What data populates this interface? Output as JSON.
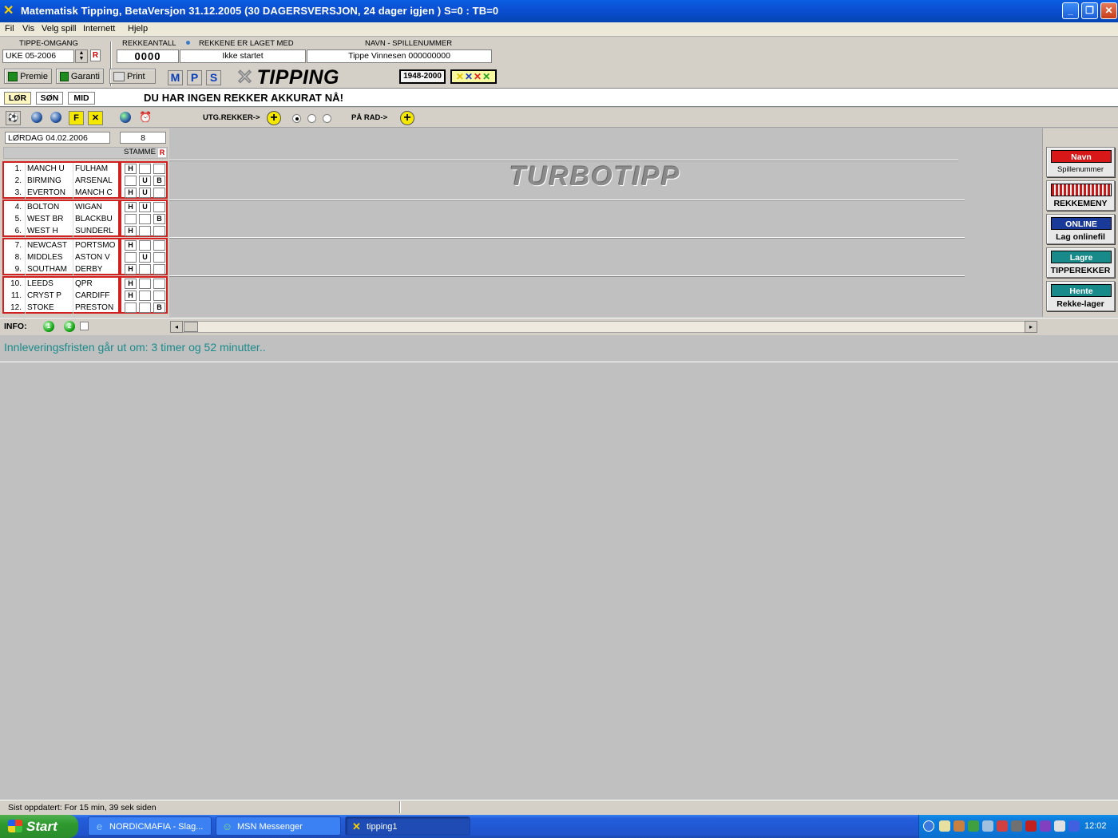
{
  "window": {
    "title": "Matematisk Tipping, BetaVersjon 31.12.2005 (30 DAGERSVERSJON, 24 dager igjen ) S=0 : TB=0",
    "minimize": "_",
    "maximize": "❐",
    "close": "✕"
  },
  "menu": [
    "Fil",
    "Vis",
    "Velg spill",
    "Internett",
    "Hjelp"
  ],
  "header": {
    "omgang_label": "TIPPE-OMGANG",
    "omgang_value": "UKE 05-2006",
    "r_button": "R",
    "rekkeantall_label": "REKKEANTALL",
    "rekkeantall_value": "0000",
    "laget_label": "REKKENE ER LAGET MED",
    "laget_value": "Ikke startet",
    "navn_label": "NAVN  -  SPILLENUMMER",
    "navn_value": "Tippe Vinnesen 000000000"
  },
  "toolbar": {
    "premie": "Premie",
    "garanti": "Garanti",
    "print": "Print",
    "m": "M",
    "p": "P",
    "s": "S",
    "logo": "TIPPING",
    "years": "1948-2000"
  },
  "days": {
    "tabs": [
      "LØR",
      "SØN",
      "MID"
    ],
    "message": "DU HAR INGEN REKKER AKKURAT NÅ!"
  },
  "iconbar": {
    "f_label": "F",
    "x_label": "✕",
    "utg_label": "UTG.REKKER->",
    "pa_rad_label": "PÅ RAD->",
    "plus": "+"
  },
  "coupon": {
    "date": "LØRDAG 04.02.2006",
    "count": "8",
    "stamme": "STAMME",
    "stamme_r": "R",
    "matches": [
      {
        "num": "1.",
        "home": "MANCH U",
        "away": "FULHAM",
        "marks": [
          "H",
          "",
          ""
        ]
      },
      {
        "num": "2.",
        "home": "BIRMING",
        "away": "ARSENAL",
        "marks": [
          "",
          "U",
          "B"
        ]
      },
      {
        "num": "3.",
        "home": "EVERTON",
        "away": "MANCH C",
        "marks": [
          "H",
          "U",
          ""
        ]
      },
      {
        "num": "4.",
        "home": "BOLTON",
        "away": "WIGAN",
        "marks": [
          "H",
          "U",
          ""
        ]
      },
      {
        "num": "5.",
        "home": "WEST BR",
        "away": "BLACKBU",
        "marks": [
          "",
          "",
          "B"
        ]
      },
      {
        "num": "6.",
        "home": "WEST H",
        "away": "SUNDERL",
        "marks": [
          "H",
          "",
          ""
        ]
      },
      {
        "num": "7.",
        "home": "NEWCAST",
        "away": "PORTSMO",
        "marks": [
          "H",
          "",
          ""
        ]
      },
      {
        "num": "8.",
        "home": "MIDDLES",
        "away": "ASTON V",
        "marks": [
          "",
          "U",
          ""
        ]
      },
      {
        "num": "9.",
        "home": "SOUTHAM",
        "away": "DERBY",
        "marks": [
          "H",
          "",
          ""
        ]
      },
      {
        "num": "10.",
        "home": "LEEDS",
        "away": "QPR",
        "marks": [
          "H",
          "",
          ""
        ]
      },
      {
        "num": "11.",
        "home": "CRYST P",
        "away": "CARDIFF",
        "marks": [
          "H",
          "",
          ""
        ]
      },
      {
        "num": "12.",
        "home": "STOKE",
        "away": "PRESTON",
        "marks": [
          "",
          "",
          "B"
        ]
      }
    ]
  },
  "turbotipp": "TURBOTIPP",
  "side_buttons": [
    {
      "top": "Navn",
      "bottom": "Spillenummer",
      "color": "#d81818"
    },
    {
      "top": "",
      "bottom": "REKKEMENY",
      "color": "#c81818"
    },
    {
      "top": "ONLINE",
      "bottom": "Lag onlinefil",
      "color": "#1a3a9a"
    },
    {
      "top": "Lagre",
      "bottom": "TIPPEREKKER",
      "color": "#188a8a"
    },
    {
      "top": "Hente",
      "bottom": "Rekke-lager",
      "color": "#188a8a"
    }
  ],
  "info": {
    "label": "INFO:",
    "ball1": "1",
    "ball2": "2",
    "left_arrow": "◂",
    "right_arrow": "▸"
  },
  "deadline": "Innleveringsfristen går ut om:  3 timer og 52 minutter..",
  "status": "Sist oppdatert: For 15 min, 39 sek siden",
  "taskbar": {
    "start": "Start",
    "tasks": [
      "NORDICMAFIA - Slag...",
      "MSN Messenger",
      "tipping1"
    ],
    "clock": "12:02"
  }
}
